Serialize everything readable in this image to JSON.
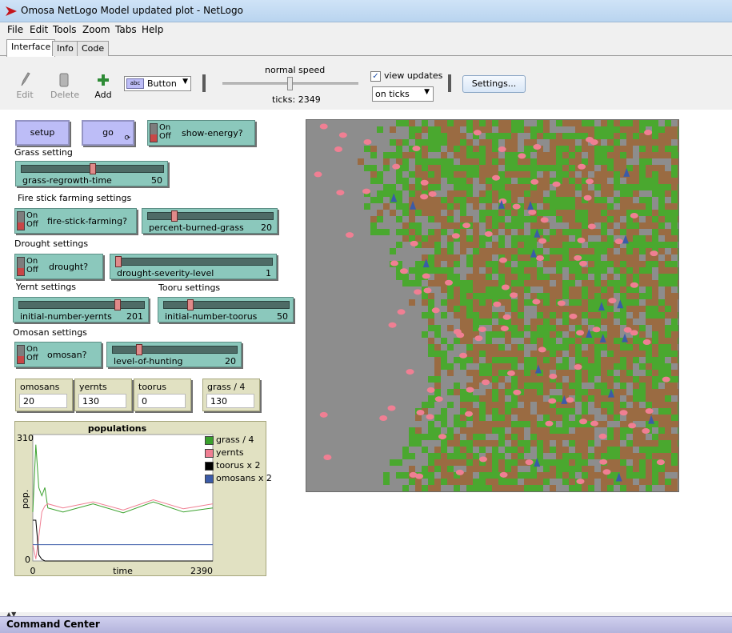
{
  "window": {
    "title": "Omosa NetLogo Model updated plot - NetLogo"
  },
  "menu": [
    "File",
    "Edit",
    "Tools",
    "Zoom",
    "Tabs",
    "Help"
  ],
  "tabs": [
    "Interface",
    "Info",
    "Code"
  ],
  "toolbar": {
    "edit": "Edit",
    "delete": "Delete",
    "add": "Add",
    "widget_type": "Button",
    "speed_label": "normal speed",
    "ticks": "ticks: 2349",
    "view_updates": "view updates",
    "update_mode": "on ticks",
    "settings": "Settings..."
  },
  "buttons": {
    "setup": "setup",
    "go": "go"
  },
  "switches": {
    "show_energy": "show-energy?",
    "fire_stick": "fire-stick-farming?",
    "drought": "drought?",
    "omosan": "omosan?",
    "on": "On",
    "off": "Off"
  },
  "labels": {
    "grass": "Grass setting",
    "fire": "Fire stick farming settings",
    "drought": "Drought settings",
    "yernt": "Yernt settings",
    "tooru": "Tooru settings",
    "omosan": "Omosan settings"
  },
  "sliders": {
    "grass_regrowth": {
      "name": "grass-regrowth-time",
      "value": "50",
      "fraction": 0.5
    },
    "percent_burned": {
      "name": "percent-burned-grass",
      "value": "20",
      "fraction": 0.2
    },
    "drought_severity": {
      "name": "drought-severity-level",
      "value": "1",
      "fraction": 0.0
    },
    "initial_yernts": {
      "name": "initial-number-yernts",
      "value": "201",
      "fraction": 0.8
    },
    "initial_toorus": {
      "name": "initial-number-toorus",
      "value": "50",
      "fraction": 0.2
    },
    "level_hunting": {
      "name": "level-of-hunting",
      "value": "20",
      "fraction": 0.2
    }
  },
  "monitors": [
    {
      "name": "omosans",
      "value": "20"
    },
    {
      "name": "yernts",
      "value": "130"
    },
    {
      "name": "toorus",
      "value": "0"
    },
    {
      "name": "grass / 4",
      "value": "130"
    }
  ],
  "chart_data": {
    "type": "line",
    "title": "populations",
    "xlabel": "time",
    "ylabel": "pop.",
    "xlim": [
      0,
      2390
    ],
    "ylim": [
      0,
      310
    ],
    "x_ticks": [
      "0",
      "2390"
    ],
    "y_ticks": [
      "0",
      "310"
    ],
    "legend_position": "right",
    "series": [
      {
        "name": "grass / 4",
        "color": "#3aa12d",
        "x": [
          0,
          40,
          80,
          120,
          160,
          200,
          400,
          800,
          1200,
          1600,
          2000,
          2390
        ],
        "values": [
          120,
          285,
          180,
          160,
          180,
          130,
          120,
          140,
          118,
          145,
          120,
          130
        ]
      },
      {
        "name": "yernts",
        "color": "#f07f93",
        "x": [
          0,
          40,
          80,
          120,
          160,
          200,
          400,
          800,
          1200,
          1600,
          2000,
          2390
        ],
        "values": [
          40,
          5,
          60,
          120,
          135,
          140,
          130,
          145,
          125,
          150,
          128,
          140
        ]
      },
      {
        "name": "toorus x 2",
        "color": "#000000",
        "x": [
          0,
          40,
          80,
          120,
          160,
          200,
          400,
          800,
          1200,
          1600,
          2000,
          2390
        ],
        "values": [
          100,
          100,
          15,
          4,
          0,
          0,
          0,
          0,
          0,
          0,
          0,
          0
        ]
      },
      {
        "name": "omosans x 2",
        "color": "#3b5ba8",
        "x": [
          0,
          2390
        ],
        "values": [
          40,
          40
        ]
      }
    ]
  },
  "world": {
    "colors": {
      "grass": "#4aa82f",
      "dirt": "#9a6b42",
      "gray": "#8d8d8d",
      "yernt": "#f07f93",
      "omosan": "#3b5ba8"
    }
  },
  "command_center": "Command Center"
}
